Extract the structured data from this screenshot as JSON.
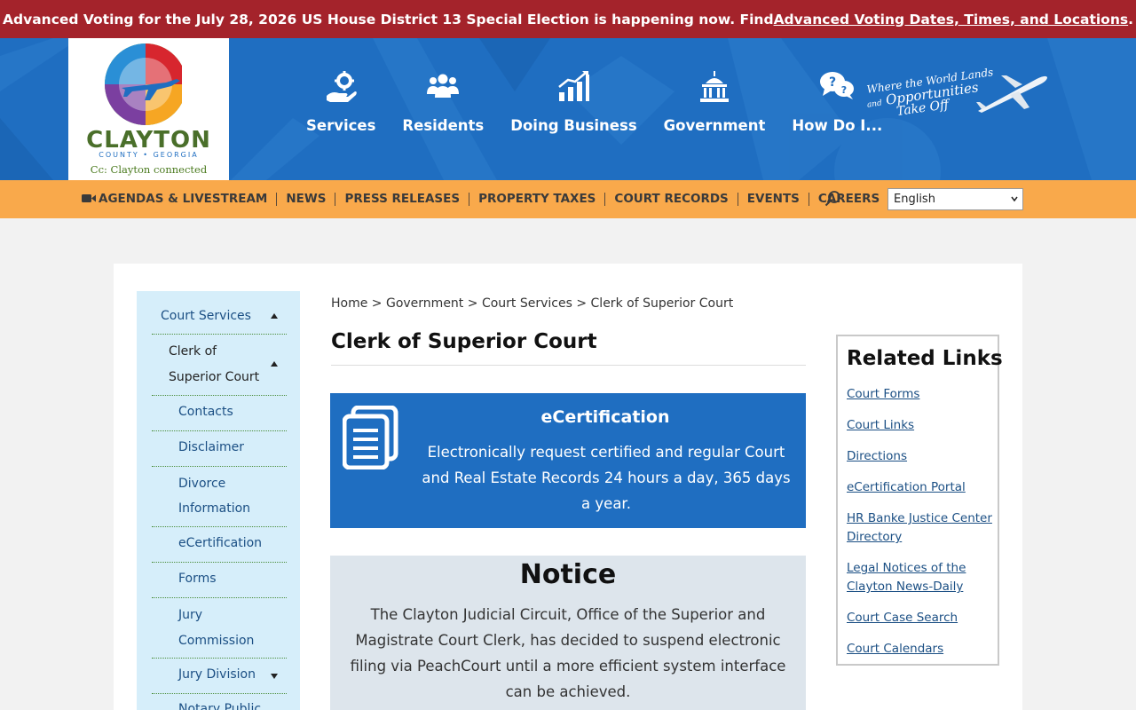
{
  "alert": {
    "text": "Advanced Voting for the July 28, 2026 US House District 13 Special Election is happening now. Find ",
    "link": "Advanced Voting Dates, Times, and Locations",
    "end": "."
  },
  "logo": {
    "name": "CLAYTON",
    "county": "COUNTY • GEORGIA",
    "tagline": "Cc: Clayton connected"
  },
  "main_nav": [
    {
      "label": "Services",
      "icon": "gear-hand-icon"
    },
    {
      "label": "Residents",
      "icon": "people-icon"
    },
    {
      "label": "Doing Business",
      "icon": "chart-icon"
    },
    {
      "label": "Government",
      "icon": "capitol-icon"
    },
    {
      "label": "How Do I...",
      "icon": "question-chat-icon"
    }
  ],
  "header_tagline": {
    "line1": "Where the World Lands",
    "line2_small": "and",
    "line2": "Opportunities",
    "line3": "Take Off"
  },
  "sub_nav": [
    "AGENDAS & LIVESTREAM",
    "NEWS",
    "PRESS RELEASES",
    "PROPERTY TAXES",
    "COURT RECORDS",
    "EVENTS",
    "CAREERS"
  ],
  "language": "English",
  "side_nav": {
    "top": "Court Services",
    "current": "Clerk of Superior Court",
    "items": [
      "Contacts",
      "Disclaimer",
      "Divorce Information",
      "eCertification",
      "Forms",
      "Jury Commission",
      "Jury Division",
      "Notary Public"
    ]
  },
  "breadcrumb": {
    "home": "Home",
    "sep": " > ",
    "government": "Government",
    "court_services": "Court Services",
    "current": "Clerk of Superior Court"
  },
  "page_title": "Clerk of Superior Court",
  "ecert": {
    "title": "eCertification",
    "text": "Electronically request certified and regular Court and Real Estate Records 24 hours a day, 365 days a year."
  },
  "notice": {
    "title": "Notice",
    "text": "The Clayton Judicial Circuit, Office of the Superior and Magistrate Court Clerk, has decided to suspend electronic filing via PeachCourt until a more efficient system interface can be achieved."
  },
  "related": {
    "title": "Related Links",
    "links": [
      "Court Forms",
      "Court Links",
      "Directions",
      "eCertification Portal",
      "HR Banke Justice Center Directory",
      "Legal Notices of the Clayton News-Daily",
      "Court Case Search",
      "Court Calendars"
    ]
  },
  "colors": {
    "alert_bg": "#a4232b",
    "header_bg": "#1f6ec1",
    "subnav_bg": "#f9a94b",
    "sidenav_bg": "#d6eefa",
    "notice_bg": "#dde5ec"
  }
}
